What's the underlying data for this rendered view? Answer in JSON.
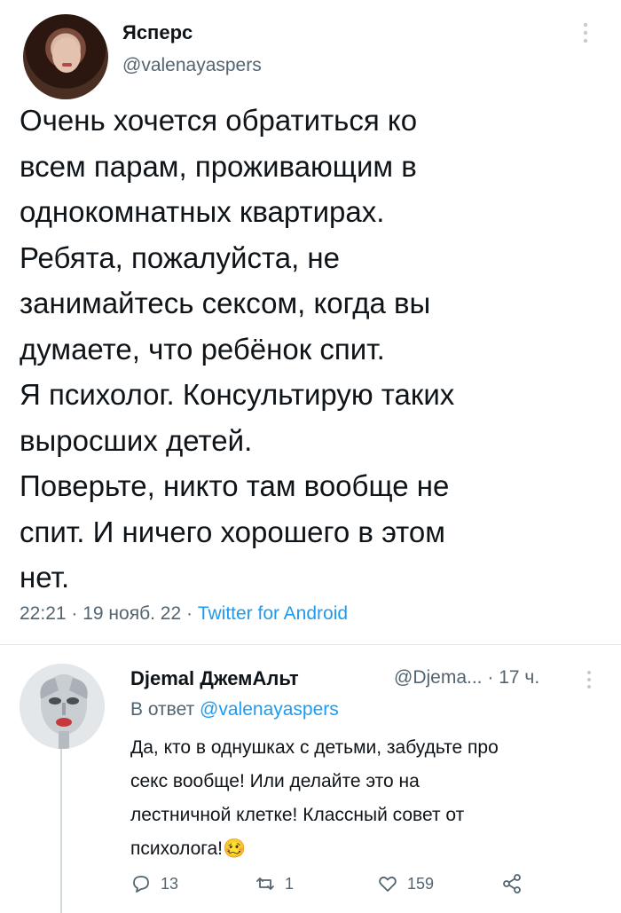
{
  "tweet": {
    "author_name": "Ясперс",
    "author_handle": "@valenayaspers",
    "text": "Очень хочется обратиться ко\nвсем парам, проживающим в\nоднокомнатных квартирах.\nРебята, пожалуйста, не\nзанимайтесь сексом, когда вы\nдумаете, что ребёнок спит.\nЯ психолог. Консультирую таких\nвыросших детей.\nПоверьте, никто там вообще не\nспит. И ничего хорошего в этом\nнет.",
    "time": "22:21",
    "date": "19 нояб. 22",
    "source": "Twitter for Android",
    "separator": " · "
  },
  "reply": {
    "author_name": "Djemal ДжемАльт",
    "author_handle": "@Djema...",
    "age": "17 ч.",
    "reply_prefix": "В ответ ",
    "reply_to": "@valenayaspers",
    "text": "Да, кто в однушках с детьми, забудьте про\nсекс вообще! Или делайте это на\nлестничной клетке! Классный совет от\nпсихолога!",
    "emoji": "🥴",
    "stats": {
      "replies": "13",
      "retweets": "1",
      "likes": "159"
    }
  },
  "icons": {
    "more": "more-vertical-icon",
    "reply": "reply-icon",
    "retweet": "retweet-icon",
    "like": "heart-icon",
    "share": "share-icon"
  },
  "colors": {
    "link": "#1d9bf0",
    "muted": "#536471",
    "text": "#0f1419"
  }
}
